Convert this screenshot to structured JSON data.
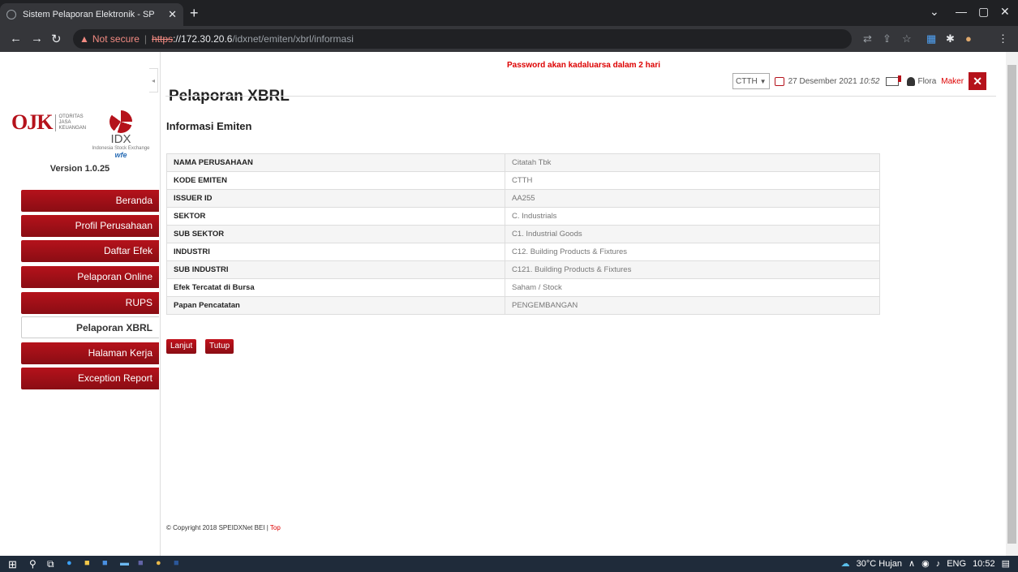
{
  "browser": {
    "tab_title": "Sistem Pelaporan Elektronik - SP",
    "new_tab": "+",
    "url_security": "Not secure",
    "url_scheme": "https",
    "url_host": "://172.30.20.6",
    "url_path": "/idxnet/emiten/xbrl/informasi"
  },
  "sidebar": {
    "ojk_letters": "OJK",
    "ojk_text": "OTORITAS JASA KEUANGAN",
    "idx_text": "IDX",
    "idx_sub": "Indonesia Stock Exchange",
    "idx_wfe": "wfe",
    "version": "Version 1.0.25",
    "items": [
      {
        "label": "Beranda"
      },
      {
        "label": "Profil Perusahaan"
      },
      {
        "label": "Daftar Efek"
      },
      {
        "label": "Pelaporan Online"
      },
      {
        "label": "RUPS"
      },
      {
        "label": "Pelaporan XBRL"
      },
      {
        "label": "Halaman Kerja"
      },
      {
        "label": "Exception Report"
      }
    ]
  },
  "header": {
    "alert": "Password akan kadaluarsa dalam 2 hari",
    "title": "Pelaporan XBRL",
    "emiten": "CTTH",
    "date": "27 Desember 2021",
    "time": "10:52",
    "user": "Flora",
    "role": "Maker"
  },
  "main": {
    "section_title": "Informasi Emiten",
    "rows": [
      {
        "key": "NAMA PERUSAHAAN",
        "value": "Citatah Tbk"
      },
      {
        "key": "KODE EMITEN",
        "value": "CTTH"
      },
      {
        "key": "ISSUER ID",
        "value": "AA255"
      },
      {
        "key": "SEKTOR",
        "value": "C. Industrials"
      },
      {
        "key": "SUB SEKTOR",
        "value": "C1. Industrial Goods"
      },
      {
        "key": "INDUSTRI",
        "value": "C12. Building Products & Fixtures"
      },
      {
        "key": "SUB INDUSTRI",
        "value": "C121. Building Products & Fixtures"
      },
      {
        "key": "Efek Tercatat di Bursa",
        "value": "Saham / Stock"
      },
      {
        "key": "Papan Pencatatan",
        "value": "PENGEMBANGAN"
      }
    ],
    "btn_next": "Lanjut",
    "btn_close": "Tutup",
    "copyright": "© Copyright 2018 SPEIDXNet BEI |",
    "top_link": "Top"
  },
  "taskbar": {
    "weather": "30°C Hujan",
    "lang": "ENG",
    "clock": "10:52"
  },
  "colors": {
    "brand": "#b5121b",
    "alert": "#dd0000"
  }
}
